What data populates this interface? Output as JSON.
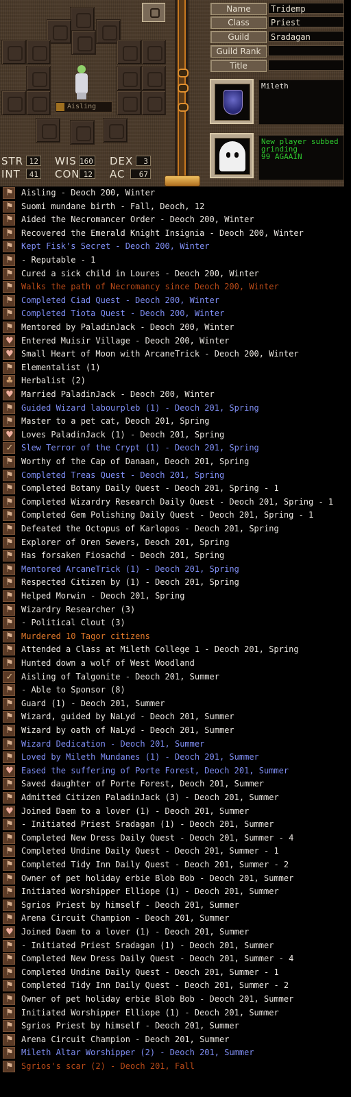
{
  "profile": {
    "name_label": "Name",
    "name_value": "Tridemp",
    "class_label": "Class",
    "class_value": "Priest",
    "guild_label": "Guild",
    "guild_value": "Sradagan",
    "guild_rank_label": "Guild Rank",
    "guild_rank_value": "",
    "title_label": "Title",
    "title_value": "",
    "nation": "Mileth",
    "message_lines": [
      "New player subbed",
      "grinding",
      "99 AGAAIN"
    ]
  },
  "character": {
    "name_plate": "Aisling"
  },
  "stats": {
    "str_label": "STR",
    "str": "12",
    "int_label": "INT",
    "int": "41",
    "wis_label": "WIS",
    "wis": "160",
    "con_label": "CON",
    "con": "12",
    "dex_label": "DEX",
    "dex": "3",
    "ac_label": "AC",
    "ac": "67"
  },
  "colors": {
    "white": "#eae6e0",
    "blue": "#7f8ef4",
    "orange": "#e0782a",
    "darkorange": "#b84a18",
    "message_green": "#2ec82e"
  },
  "legend": [
    {
      "icon": "mark",
      "color": "white",
      "text": "Aisling - Deoch 200, Winter"
    },
    {
      "icon": "mark",
      "color": "white",
      "text": "Suomi mundane birth - Fall, Deoch, 12"
    },
    {
      "icon": "mark",
      "color": "white",
      "text": "Aided the Necromancer Order - Deoch 200, Winter"
    },
    {
      "icon": "mark",
      "color": "white",
      "text": "Recovered the Emerald Knight Insignia - Deoch 200, Winter"
    },
    {
      "icon": "mark",
      "color": "blue",
      "text": "Kept Fisk's Secret - Deoch 200, Winter"
    },
    {
      "icon": "mark",
      "color": "white",
      "text": "- Reputable - 1"
    },
    {
      "icon": "mark",
      "color": "white",
      "text": "Cured a sick child in Loures - Deoch 200, Winter"
    },
    {
      "icon": "mark",
      "color": "darkorange",
      "text": "Walks the path of Necromancy since Deoch 200, Winter"
    },
    {
      "icon": "mark",
      "color": "blue",
      "text": "Completed Ciad Quest - Deoch 200, Winter"
    },
    {
      "icon": "mark",
      "color": "blue",
      "text": "Completed Tiota Quest - Deoch 200, Winter"
    },
    {
      "icon": "mark",
      "color": "white",
      "text": "Mentored by PaladinJack - Deoch 200, Winter"
    },
    {
      "icon": "heart",
      "color": "white",
      "text": "Entered Muisir Village - Deoch 200, Winter"
    },
    {
      "icon": "heart",
      "color": "white",
      "text": "Small Heart of Moon with ArcaneTrick - Deoch 200, Winter"
    },
    {
      "icon": "mark",
      "color": "white",
      "text": "Elementalist (1)"
    },
    {
      "icon": "herb",
      "color": "white",
      "text": "Herbalist (2)"
    },
    {
      "icon": "heart",
      "color": "white",
      "text": "Married PaladinJack - Deoch 200, Winter"
    },
    {
      "icon": "mark",
      "color": "blue",
      "text": "Guided Wizard labourpleb (1) - Deoch 201, Spring"
    },
    {
      "icon": "mark",
      "color": "white",
      "text": "Master to a pet cat, Deoch 201, Spring"
    },
    {
      "icon": "heart",
      "color": "white",
      "text": "Loves PaladinJack (1) - Deoch 201, Spring"
    },
    {
      "icon": "check",
      "color": "blue",
      "text": "Slew Terror of the Crypt (1) - Deoch 201, Spring"
    },
    {
      "icon": "mark",
      "color": "white",
      "text": "Worthy of the Cap of Danaan, Deoch 201, Spring"
    },
    {
      "icon": "mark",
      "color": "blue",
      "text": "Completed Treas Quest - Deoch 201, Spring"
    },
    {
      "icon": "mark",
      "color": "white",
      "text": "Completed Botany Daily Quest - Deoch 201, Spring - 1"
    },
    {
      "icon": "mark",
      "color": "white",
      "text": "Completed Wizardry Research Daily Quest - Deoch 201, Spring - 1"
    },
    {
      "icon": "mark",
      "color": "white",
      "text": "Completed Gem Polishing Daily Quest - Deoch 201, Spring - 1"
    },
    {
      "icon": "mark",
      "color": "white",
      "text": "Defeated the Octopus of Karlopos - Deoch 201, Spring"
    },
    {
      "icon": "mark",
      "color": "white",
      "text": "Explorer of Oren Sewers, Deoch 201, Spring"
    },
    {
      "icon": "mark",
      "color": "white",
      "text": "Has forsaken Fiosachd - Deoch 201, Spring"
    },
    {
      "icon": "mark",
      "color": "blue",
      "text": "Mentored ArcaneTrick (1) - Deoch 201, Spring"
    },
    {
      "icon": "mark",
      "color": "white",
      "text": "Respected Citizen by  (1) - Deoch 201, Spring"
    },
    {
      "icon": "mark",
      "color": "white",
      "text": "Helped Morwin - Deoch 201, Spring"
    },
    {
      "icon": "mark",
      "color": "white",
      "text": "Wizardry Researcher (3)"
    },
    {
      "icon": "mark",
      "color": "white",
      "text": "- Political Clout (3)"
    },
    {
      "icon": "mark",
      "color": "orange",
      "text": "Murdered 10 Tagor citizens"
    },
    {
      "icon": "mark",
      "color": "white",
      "text": "Attended a Class at Mileth College 1 - Deoch 201, Spring"
    },
    {
      "icon": "mark",
      "color": "white",
      "text": "Hunted down a wolf of West Woodland"
    },
    {
      "icon": "check",
      "color": "white",
      "text": "Aisling of Talgonite - Deoch 201, Summer"
    },
    {
      "icon": "mark",
      "color": "white",
      "text": "- Able to Sponsor (8)"
    },
    {
      "icon": "mark",
      "color": "white",
      "text": "Guard (1) - Deoch 201, Summer"
    },
    {
      "icon": "mark",
      "color": "white",
      "text": "Wizard, guided by NaLyd - Deoch 201, Summer"
    },
    {
      "icon": "mark",
      "color": "white",
      "text": "Wizard by oath of NaLyd - Deoch 201, Summer"
    },
    {
      "icon": "mark",
      "color": "blue",
      "text": "Wizard Dedication - Deoch 201, Summer"
    },
    {
      "icon": "mark",
      "color": "blue",
      "text": "Loved by Mileth Mundanes (1) - Deoch 201, Summer"
    },
    {
      "icon": "heart",
      "color": "blue",
      "text": "Eased the suffering of Porte Forest, Deoch 201, Summer"
    },
    {
      "icon": "mark",
      "color": "white",
      "text": "Saved daughter of Porte Forest, Deoch 201, Summer"
    },
    {
      "icon": "mark",
      "color": "white",
      "text": "Admitted Citizen PaladinJack (3) - Deoch 201, Summer"
    },
    {
      "icon": "heart",
      "color": "white",
      "text": "Joined Daem to a lover (1) - Deoch 201, Summer"
    },
    {
      "icon": "mark",
      "color": "white",
      "text": "- Initiated Priest Sradagan (1) - Deoch 201, Summer"
    },
    {
      "icon": "mark",
      "color": "white",
      "text": "Completed New Dress Daily Quest - Deoch 201, Summer - 4"
    },
    {
      "icon": "mark",
      "color": "white",
      "text": "Completed Undine Daily Quest - Deoch 201, Summer - 1"
    },
    {
      "icon": "mark",
      "color": "white",
      "text": "Completed Tidy Inn Daily Quest - Deoch 201, Summer - 2"
    },
    {
      "icon": "mark",
      "color": "white",
      "text": "Owner of pet holiday erbie Blob Bob - Deoch 201, Summer"
    },
    {
      "icon": "mark",
      "color": "white",
      "text": "Initiated Worshipper Elliope (1) - Deoch 201, Summer"
    },
    {
      "icon": "mark",
      "color": "white",
      "text": "Sgrios Priest by himself - Deoch 201, Summer"
    },
    {
      "icon": "mark",
      "color": "white",
      "text": "Arena Circuit Champion - Deoch 201, Summer"
    },
    {
      "icon": "heart",
      "color": "white",
      "text": "Joined Daem to a lover (1) - Deoch 201, Summer"
    },
    {
      "icon": "mark",
      "color": "white",
      "text": "- Initiated Priest Sradagan (1) - Deoch 201, Summer"
    },
    {
      "icon": "mark",
      "color": "white",
      "text": "Completed New Dress Daily Quest - Deoch 201, Summer - 4"
    },
    {
      "icon": "mark",
      "color": "white",
      "text": "Completed Undine Daily Quest - Deoch 201, Summer - 1"
    },
    {
      "icon": "mark",
      "color": "white",
      "text": "Completed Tidy Inn Daily Quest - Deoch 201, Summer - 2"
    },
    {
      "icon": "mark",
      "color": "white",
      "text": "Owner of pet holiday erbie Blob Bob - Deoch 201, Summer"
    },
    {
      "icon": "mark",
      "color": "white",
      "text": "Initiated Worshipper Elliope (1) - Deoch 201, Summer"
    },
    {
      "icon": "mark",
      "color": "white",
      "text": "Sgrios Priest by himself - Deoch 201, Summer"
    },
    {
      "icon": "mark",
      "color": "white",
      "text": "Arena Circuit Champion - Deoch 201, Summer"
    },
    {
      "icon": "mark",
      "color": "blue",
      "text": "Mileth Altar Worshipper (2) - Deoch 201, Summer"
    },
    {
      "icon": "mark",
      "color": "darkorange",
      "text": "Sgrios's scar (2) - Deoch 201, Fall"
    }
  ]
}
